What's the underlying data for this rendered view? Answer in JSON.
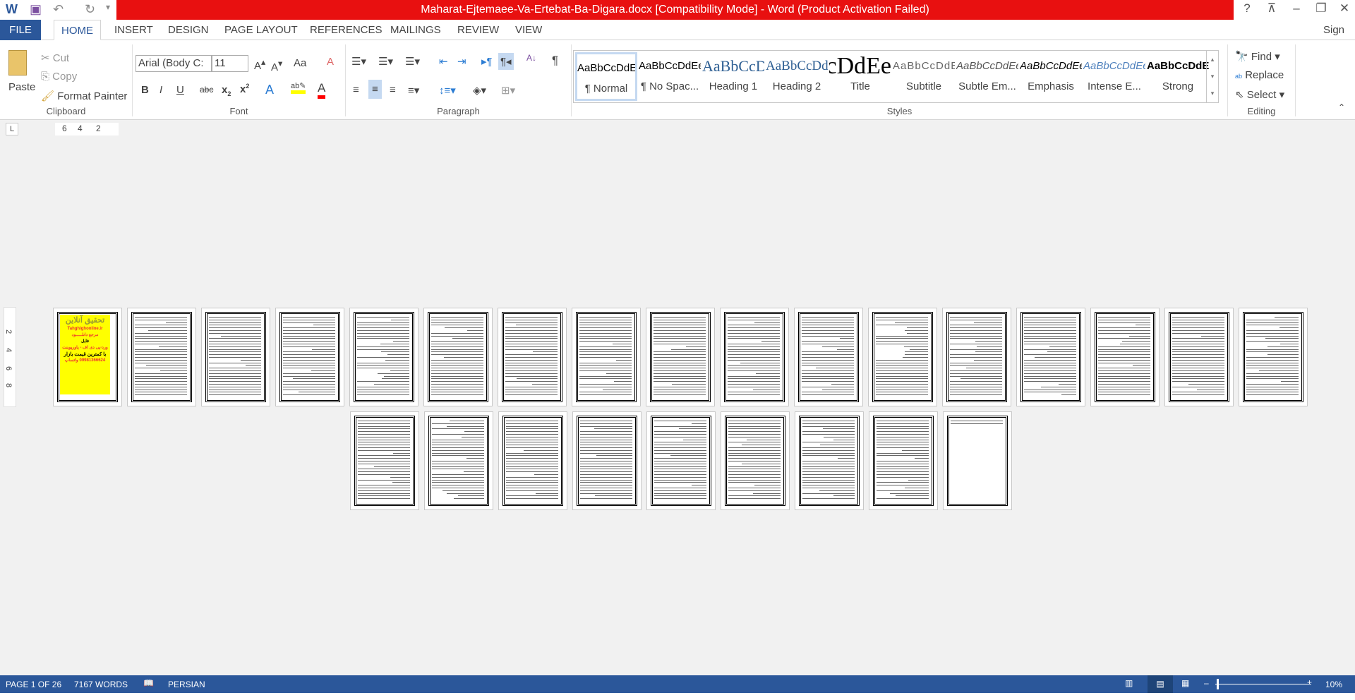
{
  "window": {
    "title": "Maharat-Ejtemaee-Va-Ertebat-Ba-Digara.docx [Compatibility Mode] -  Word (Product Activation Failed)",
    "help": "?",
    "signin": "Sign in"
  },
  "tabs": [
    {
      "label": "FILE"
    },
    {
      "label": "HOME",
      "active": true
    },
    {
      "label": "INSERT"
    },
    {
      "label": "DESIGN"
    },
    {
      "label": "PAGE LAYOUT"
    },
    {
      "label": "REFERENCES"
    },
    {
      "label": "MAILINGS"
    },
    {
      "label": "REVIEW"
    },
    {
      "label": "VIEW"
    }
  ],
  "clipboard": {
    "paste": "Paste",
    "cut": "Cut",
    "copy": "Copy",
    "format_painter": "Format Painter",
    "label": "Clipboard"
  },
  "font": {
    "name": "Arial (Body C:",
    "size": "11",
    "label": "Font",
    "change_case": "Aa",
    "bold": "B",
    "italic": "I",
    "underline": "U",
    "strike": "abc",
    "highlight_color": "#ffff00",
    "font_color": "#ff0000"
  },
  "paragraph": {
    "label": "Paragraph"
  },
  "styles": {
    "label": "Styles",
    "items": [
      {
        "preview": "AaBbCcDdEe",
        "name": "¶ Normal",
        "selected": true
      },
      {
        "preview": "AaBbCcDdEe",
        "name": "¶ No Spac..."
      },
      {
        "preview": "AaBbCcDdEe",
        "name": "Heading 1"
      },
      {
        "preview": "AaBbCcDdEe",
        "name": "Heading 2"
      },
      {
        "preview": "AaBbCcDdEe",
        "name": "Title"
      },
      {
        "preview": "AaBbCcDdEe",
        "name": "Subtitle"
      },
      {
        "preview": "AaBbCcDdEe",
        "name": "Subtle Em..."
      },
      {
        "preview": "AaBbCcDdEe",
        "name": "Emphasis"
      },
      {
        "preview": "AaBbCcDdEe",
        "name": "Intense E..."
      },
      {
        "preview": "AaBbCcDdEe",
        "name": "Strong"
      }
    ]
  },
  "editing": {
    "find": "Find",
    "replace": "Replace",
    "select": "Select",
    "label": "Editing"
  },
  "ruler": {
    "tab_selector": "L",
    "numbers": [
      "6",
      "4",
      "2"
    ],
    "vertical_numbers": [
      "2",
      "4",
      "6",
      "8"
    ]
  },
  "document": {
    "page_count": 26,
    "cover": {
      "line1": "تحقیق آنلاین",
      "site": "Tahghighonline.ir",
      "line2": "مرجع دانلـــــود",
      "line3": "فایل",
      "line4": "ورد-پی دی اف - پاورپوینت",
      "line5": "با کمترین قیمت بازار",
      "line6": "09981366624 واتساپ"
    }
  },
  "status": {
    "page": "PAGE 1 OF 26",
    "words": "7167 WORDS",
    "language": "PERSIAN",
    "zoom": "10%"
  },
  "colors": {
    "title_bar": "#e81010",
    "accent": "#2b579a"
  }
}
